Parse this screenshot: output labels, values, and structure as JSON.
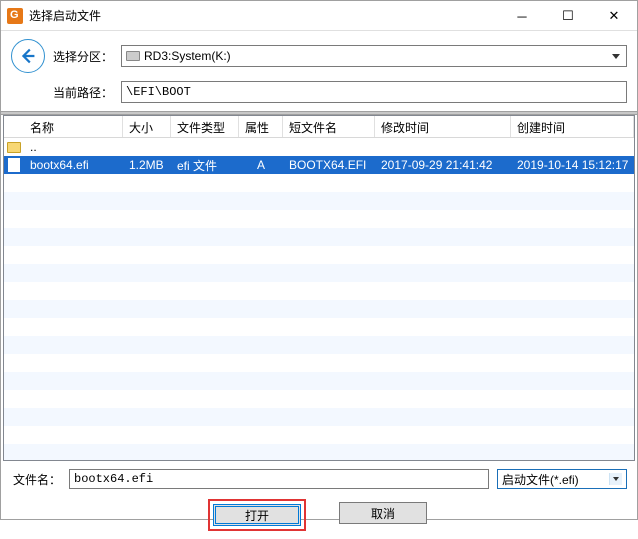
{
  "title": "选择启动文件",
  "toolbar": {
    "partition_label": "选择分区：",
    "partition_value": "RD3:System(K:)",
    "path_label": "当前路径：",
    "path_value": "\\EFI\\BOOT"
  },
  "columns": {
    "name": "名称",
    "size": "大小",
    "type": "文件类型",
    "attr": "属性",
    "short": "短文件名",
    "mtime": "修改时间",
    "ctime": "创建时间"
  },
  "rows": [
    {
      "icon": "folder",
      "name": "..",
      "size": "",
      "type": "",
      "attr": "",
      "short": "",
      "mtime": "",
      "ctime": "",
      "selected": false
    },
    {
      "icon": "file",
      "name": "bootx64.efi",
      "size": "1.2MB",
      "type": "efi 文件",
      "attr": "A",
      "short": "BOOTX64.EFI",
      "mtime": "2017-09-29 21:41:42",
      "ctime": "2019-10-14 15:12:17",
      "selected": true
    }
  ],
  "footer": {
    "filename_label": "文件名：",
    "filename_value": "bootx64.efi",
    "filter_value": "启动文件(*.efi)",
    "open": "打开",
    "cancel": "取消"
  }
}
